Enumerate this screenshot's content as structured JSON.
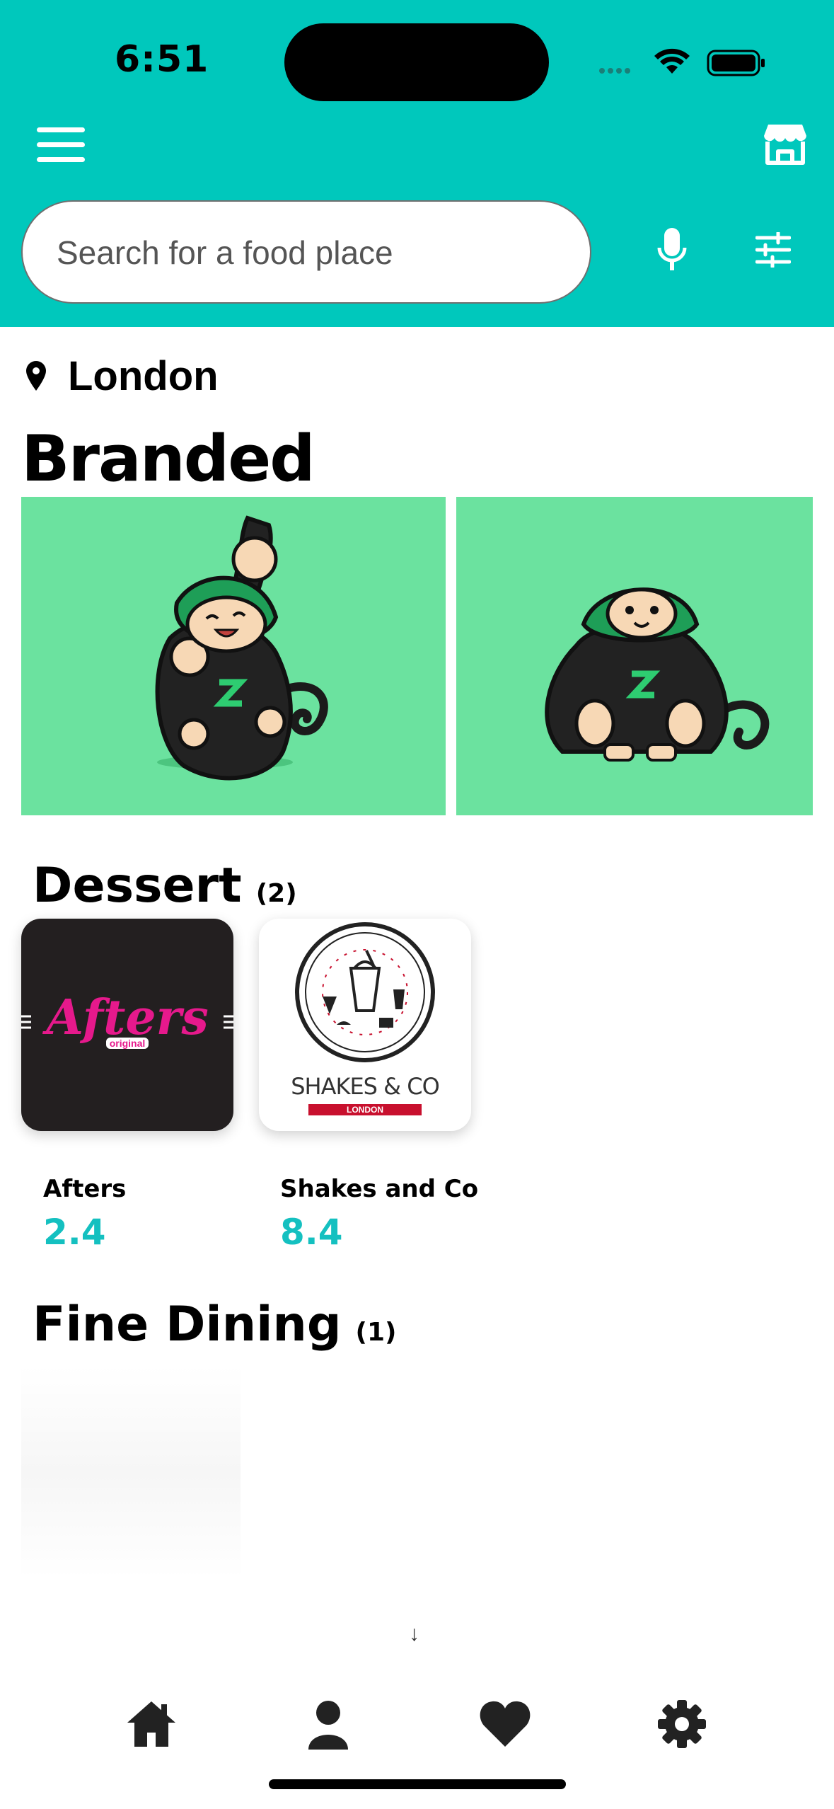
{
  "status_bar": {
    "time": "6:51"
  },
  "header": {
    "search": {
      "placeholder": "Search for a food place",
      "value": ""
    }
  },
  "location": {
    "city": "London"
  },
  "branded": {
    "title": "Branded"
  },
  "sections": [
    {
      "title": "Dessert",
      "count": "(2)",
      "places": [
        {
          "name": "Afters",
          "score": "2.4",
          "logo_text": "Afters",
          "logo_sub": "original"
        },
        {
          "name": "Shakes and Co",
          "score": "8.4",
          "logo_text": "SHAKES & CO",
          "logo_sub": "LONDON"
        }
      ]
    },
    {
      "title": "Fine Dining",
      "count": "(1)",
      "places": []
    }
  ],
  "colors": {
    "accent": "#00c8bc",
    "banner": "#6be29f",
    "score": "#14c0c0",
    "afters_pink": "#e6198c"
  },
  "tabbar": {
    "items": [
      "home-icon",
      "profile-icon",
      "heart-icon",
      "gear-icon"
    ]
  }
}
